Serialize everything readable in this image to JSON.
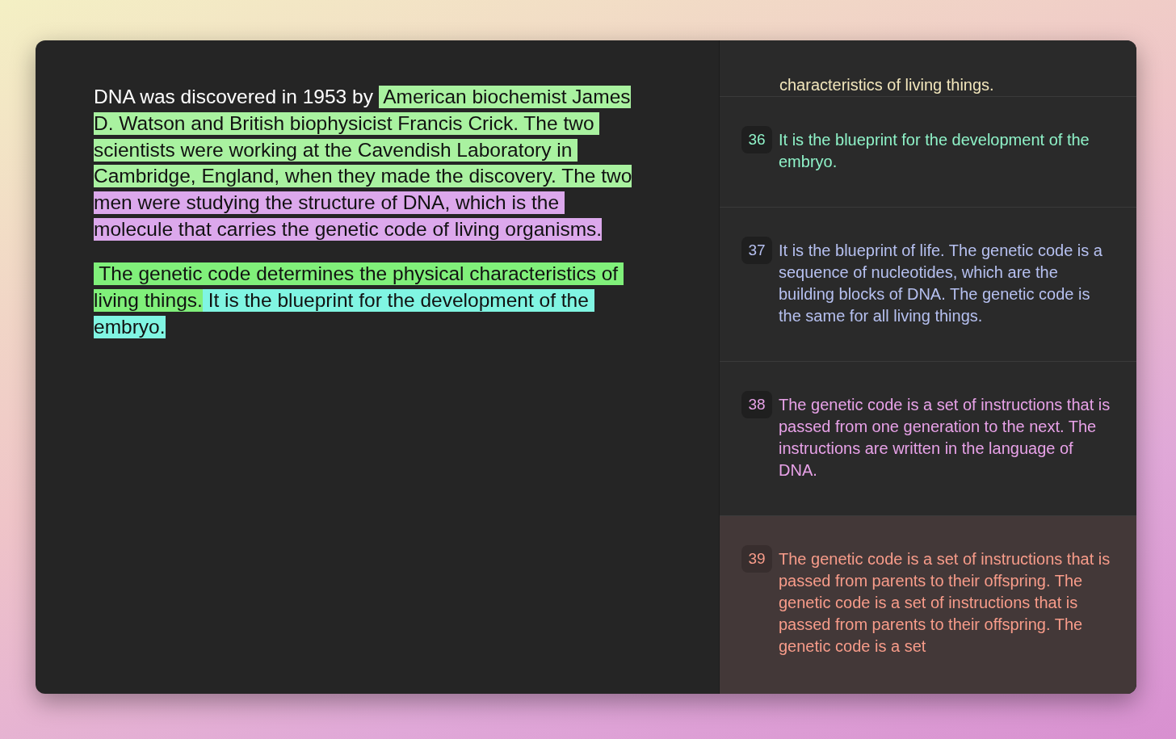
{
  "document": {
    "paragraphs": [
      {
        "lines": [
          {
            "segments": [
              {
                "text": "DNA was discovered in 1953 by "
              },
              {
                "text": " American biochemist James",
                "color": "#a9f2a0"
              }
            ]
          },
          {
            "segments": [
              {
                "text": "D. Watson and British biophysicist Francis Crick. The two ",
                "color": "#a9f2a0"
              }
            ]
          },
          {
            "segments": [
              {
                "text": "scientists were working at the Cavendish Laboratory in ",
                "color": "#a9f2a0"
              }
            ]
          },
          {
            "segments": [
              {
                "text": "Cambridge, England, when they made the discovery. The two",
                "color": "#a9f2a0"
              }
            ]
          },
          {
            "segments": [
              {
                "text": "men were studying the structure of DNA, which is the ",
                "color": "#dca8ec"
              }
            ]
          },
          {
            "segments": [
              {
                "text": "molecule that carries the genetic code of living organisms.",
                "color": "#dca8ec"
              }
            ]
          }
        ]
      },
      {
        "lines": [
          {
            "segments": [
              {
                "text": " The genetic code determines the physical characteristics of ",
                "color": "#80f07a"
              }
            ]
          },
          {
            "segments": [
              {
                "text": "living things.",
                "color": "#80f07a"
              },
              {
                "text": " It is the blueprint for the development of the ",
                "color": "#80f5e2"
              }
            ]
          },
          {
            "segments": [
              {
                "text": "embryo.",
                "color": "#80f5e2"
              }
            ]
          }
        ]
      }
    ]
  },
  "sentences": [
    {
      "text": "characteristics of living things.",
      "color": "#f2e6bc",
      "selected": false
    },
    {
      "number": "36",
      "text": "It is the blueprint for the development of the embryo.",
      "color": "#8ff2c8",
      "selected": false
    },
    {
      "number": "37",
      "text": "It is the blueprint of life. The genetic code is a sequence of nucleotides, which are the building blocks of DNA. The genetic code is the same for all living things.",
      "color": "#b6c0f0",
      "selected": false
    },
    {
      "number": "38",
      "text": "The genetic code is a set of instructions that is passed from one generation to the next. The instructions are written in the language of DNA.",
      "color": "#e8a2e8",
      "selected": false
    },
    {
      "number": "39",
      "text": "The genetic code is a set of instructions that is passed from parents to their offspring. The genetic code is a set of instructions that is passed from parents to their offspring. The genetic code is a set",
      "color": "#f89c8a",
      "selected": true
    }
  ]
}
